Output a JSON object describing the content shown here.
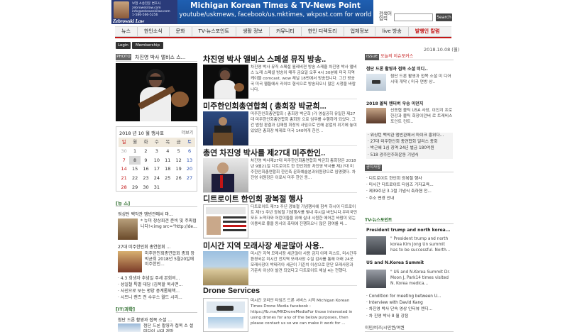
{
  "header": {
    "ad_left": {
      "line1": "보험 소송전문 변호사",
      "line2": "zebrowskilaw.com",
      "line3": "info@zebrowskilaw.com",
      "line4": "1-586-566-5256",
      "logo": "Zebrowski Law"
    },
    "banner": {
      "line1": "Michigan Korean Times & TV-News Point",
      "line2": "youtube/uskmews, facebook/us.mktimes, wkpost.com for world"
    },
    "search_label": "검색어 입력",
    "search_button": "Search"
  },
  "nav": {
    "items": [
      {
        "label": "뉴스",
        "red": false
      },
      {
        "label": "한인소식",
        "red": false
      },
      {
        "label": "문화",
        "red": false
      },
      {
        "label": "TV-뉴스포인트",
        "red": false
      },
      {
        "label": "생활 정보",
        "red": false
      },
      {
        "label": "커뮤니티",
        "red": false
      },
      {
        "label": "한인 디렉토리",
        "red": false
      },
      {
        "label": "업체정보",
        "red": false
      },
      {
        "label": "live 방송",
        "red": false
      },
      {
        "label": "발행인 칼럼",
        "red": true
      }
    ]
  },
  "login": {
    "login": "Login",
    "membership": "Membership"
  },
  "date": "2018.10.08 (월)",
  "photo": {
    "badge": "PHOTO",
    "title": "차진영 박사 앨비스 스..."
  },
  "calendar": {
    "title": "2018 년 10 월 행사표",
    "more": "더보기",
    "weekdays": [
      "일",
      "월",
      "화",
      "수",
      "목",
      "금",
      "토"
    ],
    "weeks": [
      [
        "30",
        "1",
        "2",
        "3",
        "4",
        "5",
        "6"
      ],
      [
        "7",
        "8",
        "9",
        "10",
        "11",
        "12",
        "13"
      ],
      [
        "14",
        "15",
        "16",
        "17",
        "18",
        "19",
        "20"
      ],
      [
        "21",
        "22",
        "23",
        "24",
        "25",
        "26",
        "27"
      ],
      [
        "28",
        "29",
        "30",
        "31",
        "",
        "",
        ""
      ]
    ],
    "today": "8"
  },
  "left_news": {
    "head": "[뉴 스]",
    "item1_title": "워싱턴 백악관 앰빈관에서 마...",
    "item1_text": "* 뉴미 장상회견 준비 및 주짜협니다!<img src=\"http://de...",
    "item2_title": "27대 미주한인회 총연합회 ...",
    "item2_text": "미주한인회총연합회 총회 장 박균희 2018년 5월20일에 미주한인...",
    "bullets": [
      "4.3 희생자 추념일 주세 본회의...",
      "성일철 특별 대담 (김목할 복사면...",
      "사진으로 보는 평양 풍계롬체핵...",
      "시트니 랜즈 전 수우스 월드 시리..."
    ]
  },
  "it_section": {
    "head": "[IT/과학]",
    "item_title": "첨단 드론 활영과 접목 소셜 ...",
    "item_text": "첨단 드론 활영과 접목 소 셜 미디어 시대 개막"
  },
  "articles": [
    {
      "title": "차진영 박사 앨비스 스페셜 뮤직 방송..",
      "text": "차진영 박사 뮤직 스페셜 월레비젼 방송 스케쥴 차진영 박사 앨비스 노래 스페셜 방송이 매주 금요일 오후 4시 30분에 미국 지역케이블 comcast, wow 채널 18번에서 방송됩니다. 그간 방송국 미국 웹들에서 라이브 형식으로 방송되오니 많은 시청을 바랍니다."
    },
    {
      "title": "미주한인회총연합회 ( 총회장 박균희...",
      "text": "미주한인회총연합회 ( 총회장 박균희 )가 영실공히 유일한 제27대 미주한인회총연합회 총회장 으로 임무를 수행하게 되었다. 그간 법원 판결과 김재원 회장의 사임으로 인해 분열의 위기에 놓여 있었던 총회장 체제로 미국 140여개 한인..."
    },
    {
      "title": "총연 차진영 박사를 제27대 미주한인..",
      "text": "차진영 박사제27대 미주한인회총연합회 박균희 총회장은 2018년 9월21일 디트로이트 한 한인회장 차진영 박사를 제27대 미주한인회총연합회 한인촉 문화예술분과위원장으로 임명했다. 차진영 위원장은 이로서 미주 한인 동..."
    },
    {
      "title": "디트로이트 한인회 광복절 행사",
      "text": "디트로이트 제73 주년 광복절 기념행사에 참석 하시어 디트로이트 제73 주년 광복절 기념행사를 빛내 주시길 바랍니다.우리국민 모두 노약자와 어린이들을 위해 실내 시원한 에어콘 바람이 있는 이용바로 좋을 동사의 축대에 진행하오니 많은 참여를 바..."
    },
    {
      "title": "미시간 지역 모래사장 세균많아 사용..",
      "text": "미시간 지역 모래사장 세균많아 사용 금지 아래 리스트, 미시간주 환경국은 미시간 전지역 모래사장 수질 검사를 통해 아래 24곳 모래사장이 박테리아 세균이 기준치 이상으로 판단 모래사장과 기준치 이상이 발견 되었다고 디트로이트 채널 4는 전했다."
    },
    {
      "title": "Drone Services",
      "text": "미시간 코리안 타임즈 드론 서비스 시작 Michigan Korean Times Drone Media facebook : https://fb.me/MKDroneMediaFor those interested in using drones for any of the below purposes, then please contact us so we can make it work for ..."
    }
  ],
  "right": {
    "issue_badge": "ISSUE",
    "issue_head": "오늘의 이슈포커스",
    "it_title": "첨단 드론 활영과 접목 소셜 미디..",
    "it_text": "첨단 드론 활영과 접목 소셜 미 디어 시대 개막 ( 미국 연방 상..",
    "usa_title": "2018 볼틱 엔터버 우승 이던지",
    "usa_text": "신동협 볼틱 USA 사장, 이진지 프로 한강과 볼틱 회장이던버 로 트레비스 포인트 컨트..",
    "list1": [
      "워싱턴 백악관 앰빈관에서 마이크 홍위다...",
      "27대 미주한인회 총연합회 일리스 총회",
      "박근혜 1심 징역 24년 벌금 180억원",
      "518 광주민주화운동 기념식"
    ],
    "notice_badge": "공지사항",
    "notice_list": [
      "디트로이트 한인회 광복절 행사",
      "미시간 디트로이트 타임즈 기자교육...",
      "제39주년 3.1절 기념식 축하핸 전...",
      "주소 변경 안내"
    ],
    "tv_head": "TV-뉴스포인트",
    "tv1_title": "President trump and north korea...",
    "tv1_text": "\" President trump and north korea Kim Jong Un summit has to be successful. North...",
    "tv2_title": "US and N.Korea Summit",
    "tv2_text": "\" US and N.Korea Summit Dr. Moon J, Park14 times visited N. Korea medica...",
    "tv_list": [
      "Condition for meeting between U...",
      "Interview with David Kang",
      "차진영 박사 단속 영상 인터뷰 엔디...",
      "차 진영 박사 8 월 강점"
    ],
    "bottom_head": "이민/비즈/시민권/여권"
  },
  "colors": {
    "accent": "#c31515",
    "nav_bg": "#f2f2f2",
    "banner": "#1f5fb2"
  }
}
